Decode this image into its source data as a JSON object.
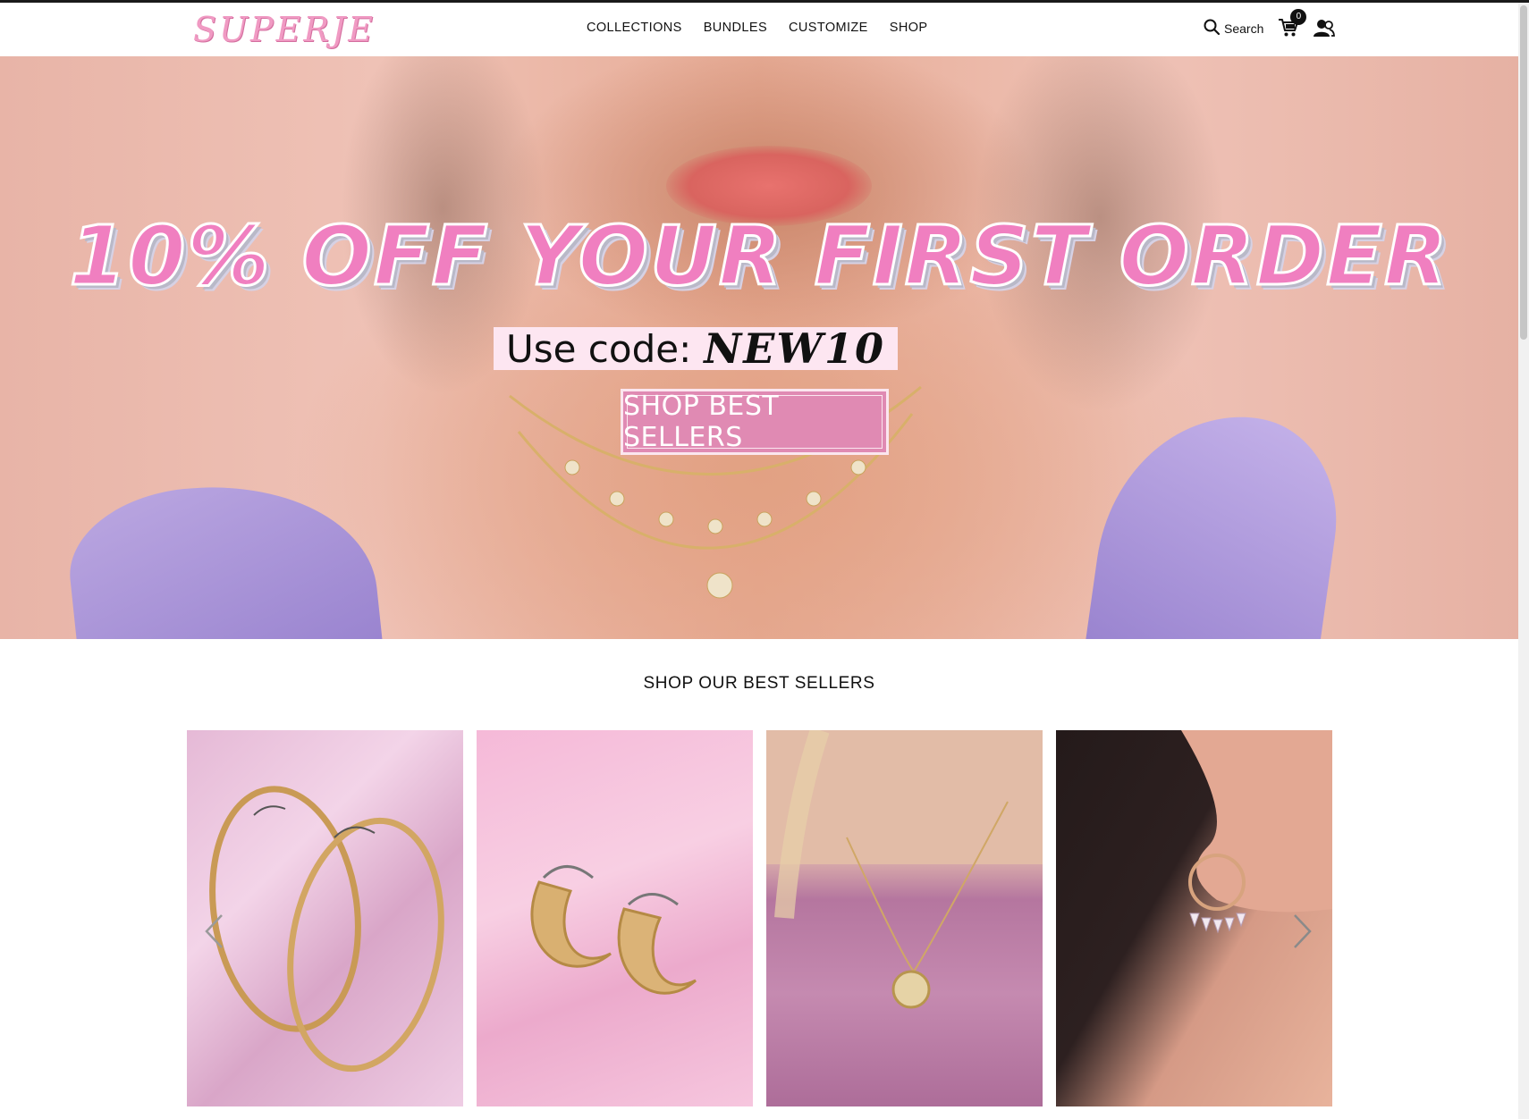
{
  "brand": {
    "logo_text": "SUPERJE",
    "accent": "#f09ac3"
  },
  "nav": {
    "items": [
      {
        "label": "COLLECTIONS"
      },
      {
        "label": "BUNDLES"
      },
      {
        "label": "CUSTOMIZE"
      },
      {
        "label": "SHOP"
      }
    ]
  },
  "header": {
    "search_label": "Search",
    "search_icon": "search-icon",
    "cart_icon": "cart-icon",
    "cart_count": "0",
    "account_icon": "account-icon"
  },
  "hero": {
    "headline": "10% OFF YOUR FIRST ORDER",
    "code_label": "Use code:",
    "code_value": "NEW10",
    "cta_label": "SHOP BEST SELLERS",
    "headline_color": "#f07fc0",
    "cta_color": "#e08ab3"
  },
  "best_sellers": {
    "title": "SHOP OUR BEST SELLERS",
    "products": [
      {
        "image": "gold-oval-hoop-earrings"
      },
      {
        "image": "gold-chunky-hoop-earrings"
      },
      {
        "image": "gold-coin-pendant-necklace"
      },
      {
        "image": "rose-gold-crystal-drop-hoop-earring"
      }
    ],
    "prev_icon": "chevron-left-icon",
    "next_icon": "chevron-right-icon"
  }
}
